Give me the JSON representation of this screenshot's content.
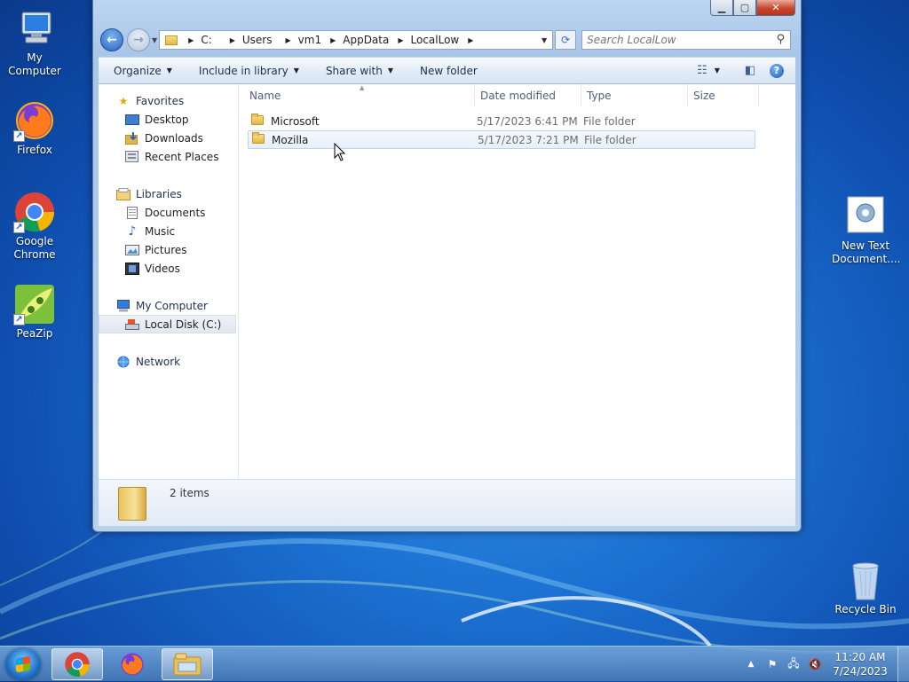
{
  "desktop": {
    "icons_left": [
      {
        "name": "My Computer",
        "icon": "computer-icon"
      },
      {
        "name": "Firefox",
        "icon": "firefox-icon"
      },
      {
        "name": "Google Chrome",
        "icon": "chrome-icon"
      },
      {
        "name": "PeaZip",
        "icon": "peazip-icon"
      }
    ],
    "icons_right": [
      {
        "name": "New Text Document....",
        "icon": "text-document-icon"
      },
      {
        "name": "Recycle Bin",
        "icon": "recycle-bin-icon"
      }
    ]
  },
  "window": {
    "address": {
      "crumbs": [
        "C:",
        "Users",
        "vm1",
        "AppData",
        "LocalLow"
      ]
    },
    "search": {
      "placeholder": "Search LocalLow"
    },
    "toolbar": {
      "organize": "Organize",
      "include_in_library": "Include in library",
      "share_with": "Share with",
      "new_folder": "New folder"
    },
    "nav": {
      "favorites": "Favorites",
      "favorites_items": [
        "Desktop",
        "Downloads",
        "Recent Places"
      ],
      "libraries": "Libraries",
      "libraries_items": [
        "Documents",
        "Music",
        "Pictures",
        "Videos"
      ],
      "my_computer": "My Computer",
      "my_computer_items": [
        "Local Disk (C:)"
      ],
      "network": "Network"
    },
    "columns": [
      "Name",
      "Date modified",
      "Type",
      "Size"
    ],
    "files": [
      {
        "name": "Microsoft",
        "date": "5/17/2023 6:41 PM",
        "type": "File folder"
      },
      {
        "name": "Mozilla",
        "date": "5/17/2023 7:21 PM",
        "type": "File folder"
      }
    ],
    "details": {
      "count": "2 items"
    }
  },
  "taskbar": {
    "time": "11:20 AM",
    "date": "7/24/2023"
  },
  "colors": {
    "desktop_blue": "#1b6fd0",
    "window_frame": "#bcd6f1",
    "close_red": "#c9462e",
    "hover_border": "#b8d4f2"
  }
}
